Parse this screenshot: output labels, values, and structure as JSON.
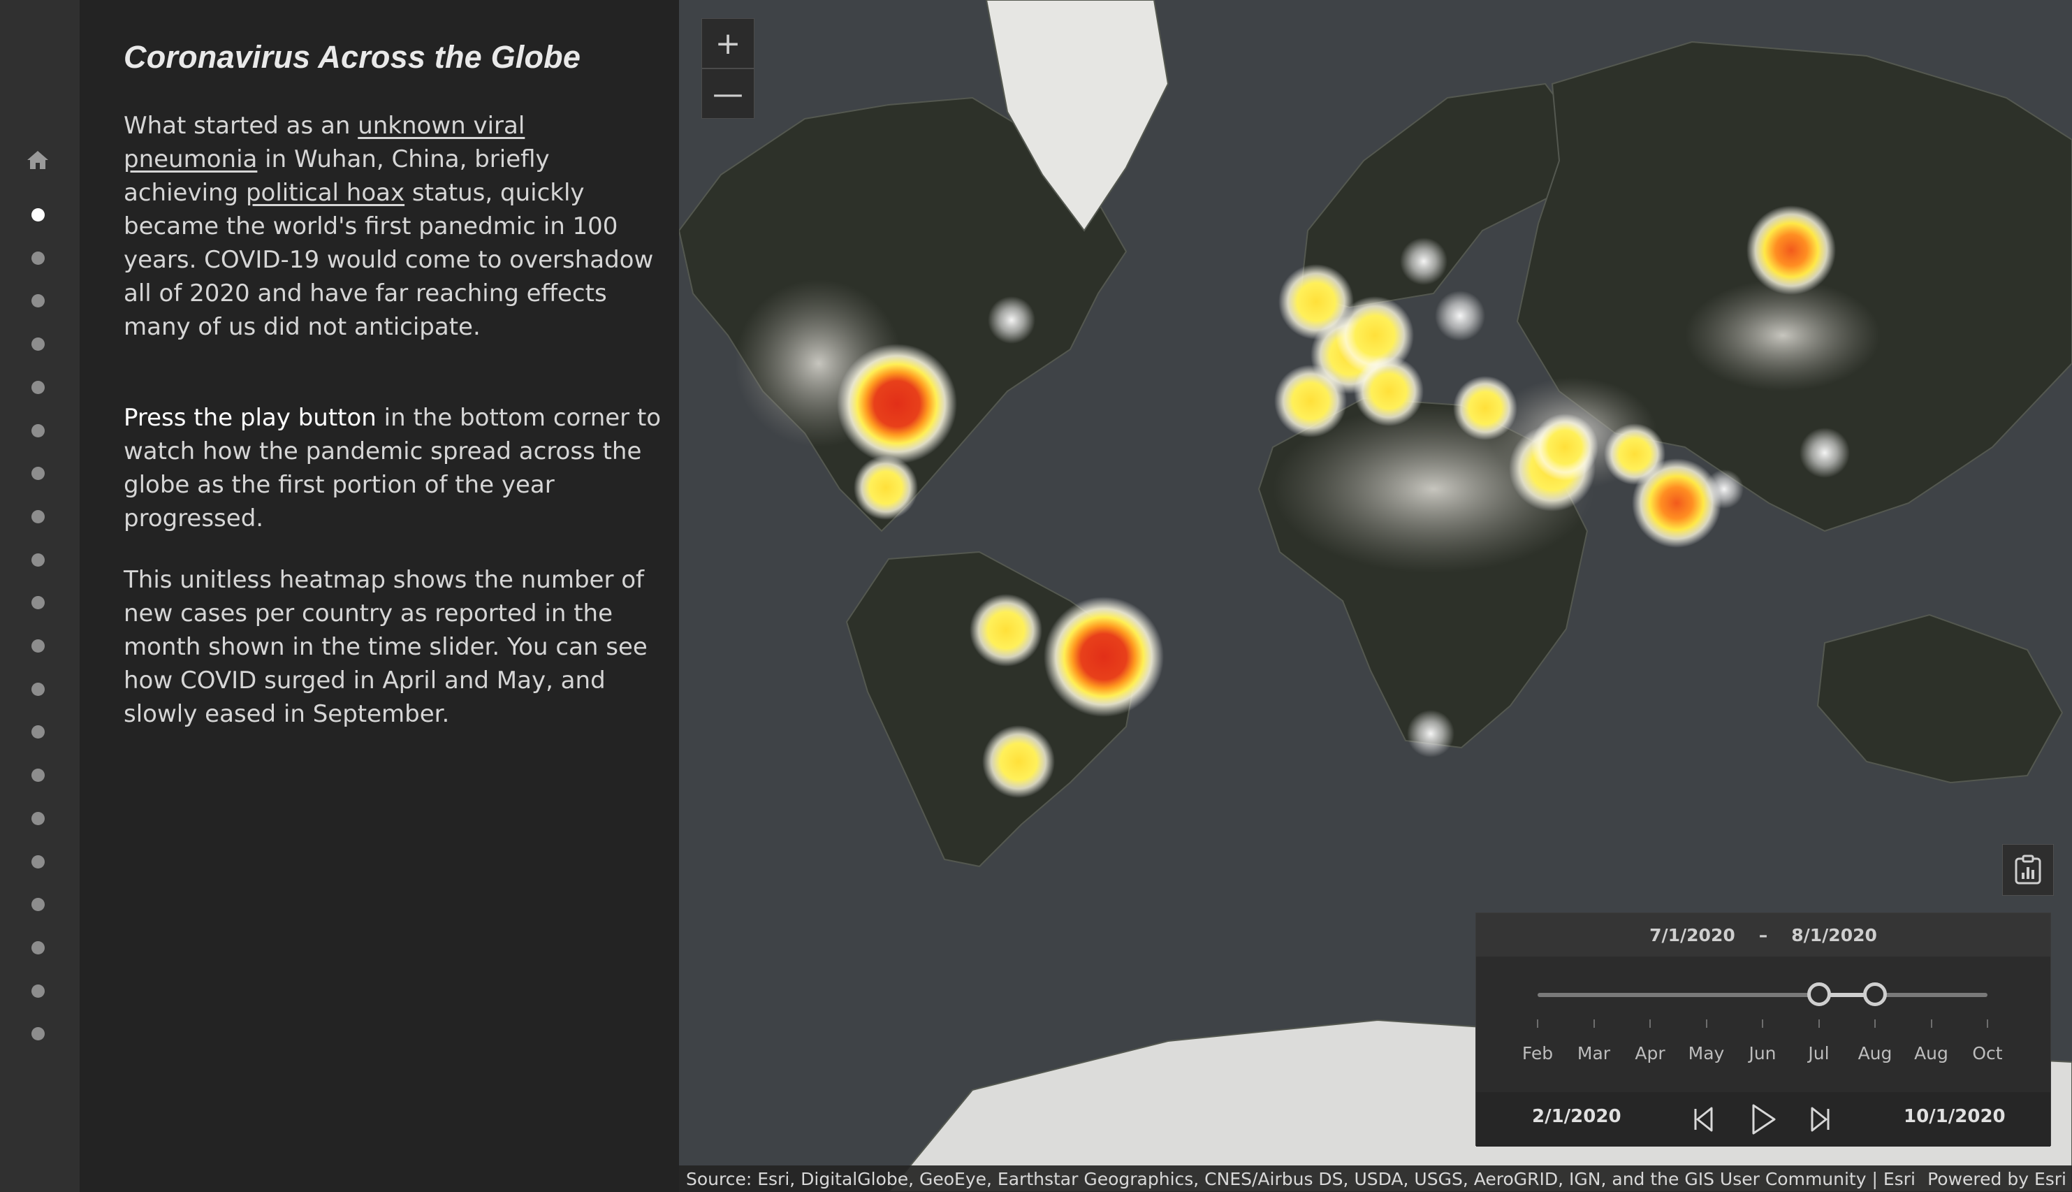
{
  "rail": {
    "home_icon": "home-icon",
    "story_dots": 20,
    "active_index": 0
  },
  "panel": {
    "title": "Coronavirus Across the Globe",
    "p1": {
      "t1": "What started as an ",
      "link1": "unknown viral pneumonia",
      "t2": " in Wuhan, China, briefly achieving ",
      "link2": "political hoax",
      "t3": " status, quickly became the world's first panedmic in 100 years. COVID-19 would come to overshadow all of 2020 and have far reaching effects many of us did not anticipate."
    },
    "p2": {
      "emphasis": "Press the play button",
      "rest": " in the bottom corner to watch how the pandemic spread across the globe as the first portion of the year progressed."
    },
    "p3": "This unitless heatmap shows the number of new cases per country as reported in the month shown in the time slider. You can see how COVID surged in April and May, and slowly eased in September."
  },
  "map": {
    "zoom_in": "+",
    "zoom_out": "—",
    "legend_icon": "legend-chart-icon",
    "colors": {
      "hot": "#e53018",
      "warm": "#ff8a1e",
      "mild": "#ffe44a",
      "cool": "#ffffff"
    },
    "hotspots": [
      {
        "name": "United States",
        "level": "hot"
      },
      {
        "name": "Mexico",
        "level": "mild"
      },
      {
        "name": "Colombia/Peru",
        "level": "mild"
      },
      {
        "name": "Brazil",
        "level": "hot"
      },
      {
        "name": "Argentina/Chile",
        "level": "mild"
      },
      {
        "name": "Western Europe",
        "level": "mild"
      },
      {
        "name": "Turkey",
        "level": "mild"
      },
      {
        "name": "Middle East",
        "level": "mild"
      },
      {
        "name": "Pakistan",
        "level": "mild"
      },
      {
        "name": "India",
        "level": "warm"
      },
      {
        "name": "Bangladesh",
        "level": "cool"
      },
      {
        "name": "Russia",
        "level": "warm"
      },
      {
        "name": "South Africa",
        "level": "cool"
      },
      {
        "name": "Canada",
        "level": "cool"
      },
      {
        "name": "China",
        "level": "cool"
      }
    ],
    "attribution": "Source: Esri, DigitalGlobe, GeoEye, Earthstar Geographics, CNES/Airbus DS, USDA, USGS, AeroGRID, IGN, and the GIS User Community | Esri",
    "powered_by": "Powered by Esri"
  },
  "time_slider": {
    "range_start": "7/1/2020",
    "range_sep": "–",
    "range_end": "8/1/2020",
    "thumb_start_fraction": 0.625,
    "thumb_end_fraction": 0.75,
    "tick_labels": [
      "Feb",
      "Mar",
      "Apr",
      "May",
      "Jun",
      "Jul",
      "Aug",
      "Aug",
      "Oct"
    ],
    "full_start": "2/1/2020",
    "full_end": "10/1/2020",
    "prev_icon": "previous-icon",
    "play_icon": "play-icon",
    "next_icon": "next-icon"
  }
}
